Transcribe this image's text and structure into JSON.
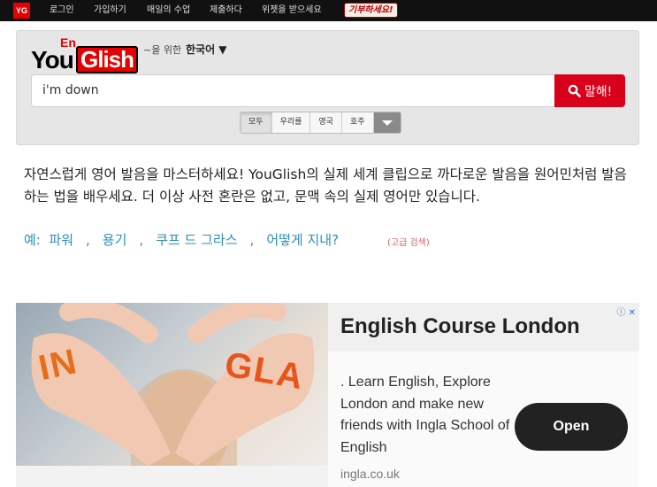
{
  "nav": {
    "logo_text": "YG",
    "items": [
      "로그인",
      "가입하기",
      "매일의 수업",
      "제출하다",
      "위젯을 받으세요"
    ],
    "donate": "기부하세요!"
  },
  "search": {
    "logo_you": "You",
    "logo_glish": "Glish",
    "logo_en": "En",
    "language_prefix": "~을 위한",
    "language_selected": "한국어 ▼",
    "query": "i'm down",
    "button_label": "말해!",
    "accent_tabs": [
      "모두",
      "우리를",
      "영국",
      "호주"
    ]
  },
  "intro": {
    "text": "자연스럽게 영어 발음을 마스터하세요! YouGlish의 실제 세계 클립으로 까다로운 발음을 원어민처럼 발음하는 법을 배우세요. 더 이상 사전 혼란은 없고, 문맥 속의 실제 영어만 있습니다.",
    "examples_label": "예:",
    "examples": [
      "파워",
      "용기",
      "쿠프 드 그라스",
      "어떻게 지내?"
    ],
    "separator": ",",
    "advanced_search": "(고급 검색)"
  },
  "ad": {
    "title": "English Course London",
    "description": ". Learn English, Explore London and make new friends with Ingla School of English",
    "domain": "ingla.co.uk",
    "cta": "Open",
    "choices_icon": "ⓘ ✕",
    "image_text_left": "IN",
    "image_text_right": "GLA"
  },
  "colors": {
    "brand_red": "#e60000",
    "button_red": "#d9001b",
    "link_blue": "#2a8fb8",
    "advanced_red": "#e65c5c"
  }
}
